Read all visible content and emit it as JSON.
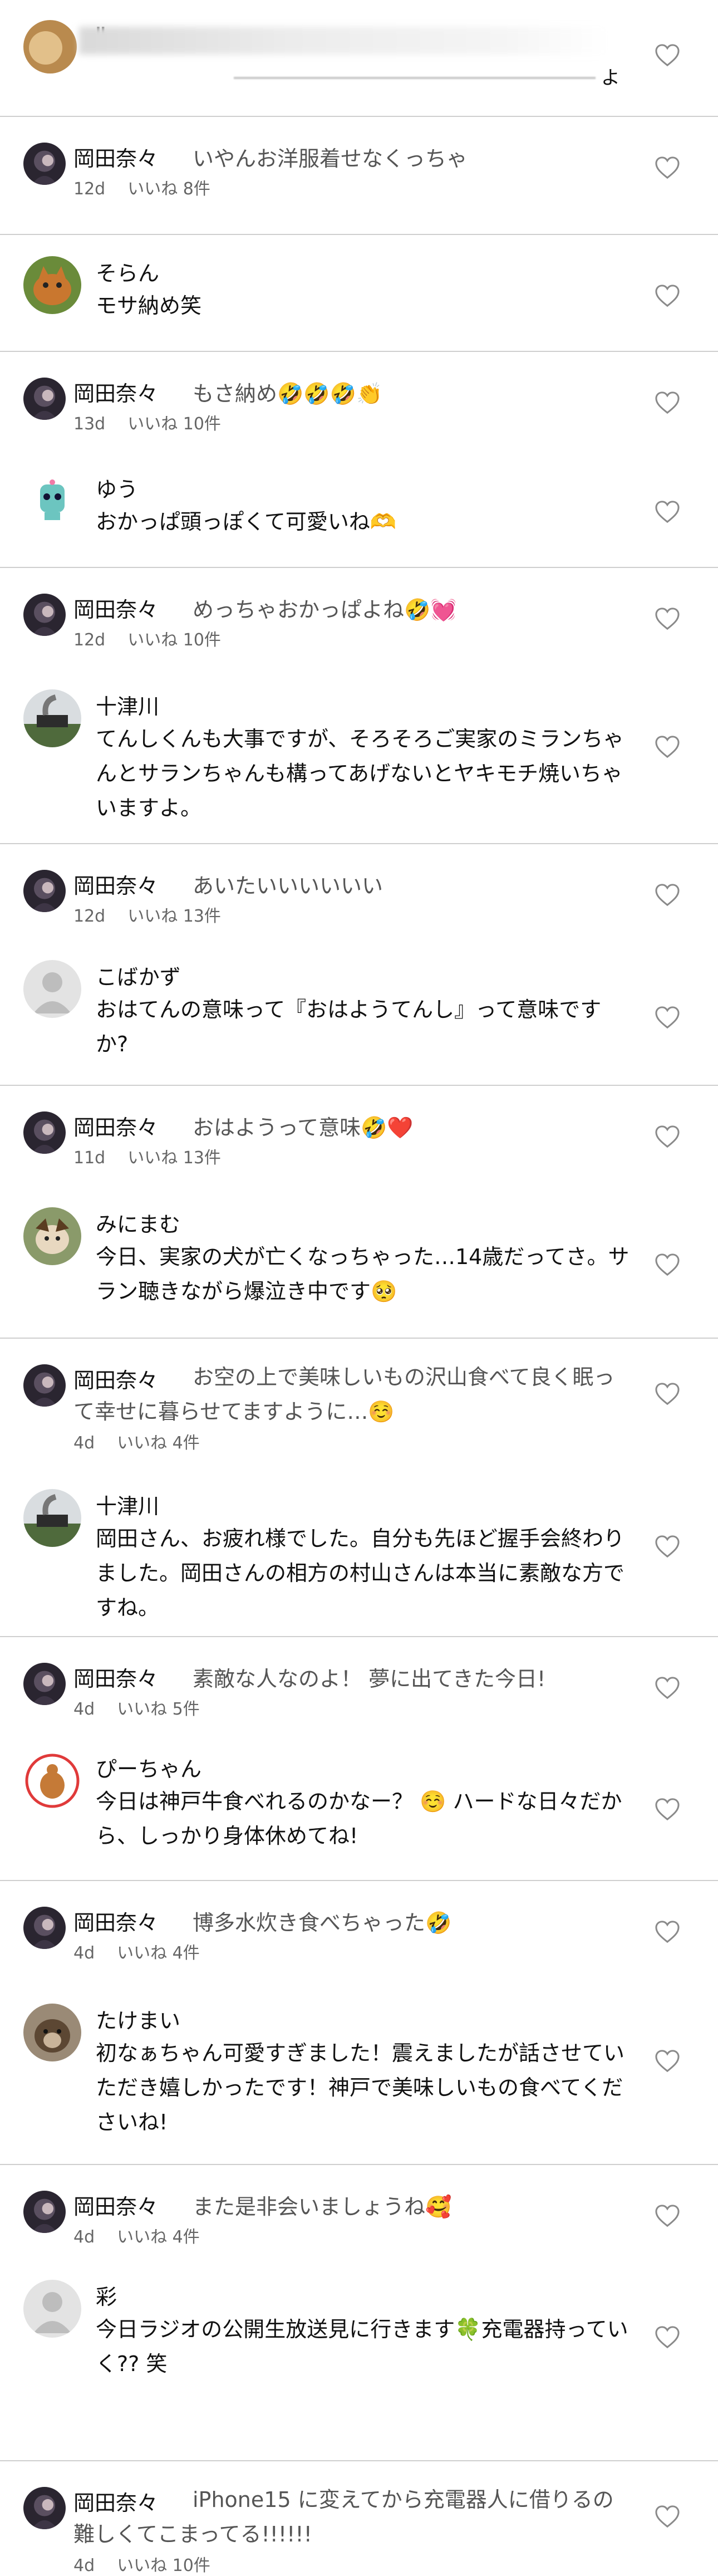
{
  "top_comment": {
    "name_fragment": "Ⅱ",
    "text_end": "よ"
  },
  "items": [
    {
      "type": "reply",
      "name": "岡田奈々",
      "text": "いやんお洋服着せなくっちゃ",
      "age": "12d",
      "likes": "いいね 8件"
    },
    {
      "type": "comment",
      "name": "そらん",
      "text": "モサ納め笑"
    },
    {
      "type": "reply",
      "name": "岡田奈々",
      "text": "もさ納め🤣🤣🤣👏",
      "age": "13d",
      "likes": "いいね 10件"
    },
    {
      "type": "comment",
      "name": "ゆう",
      "text": "おかっぱ頭っぽくて可愛いね🫶"
    },
    {
      "type": "reply",
      "name": "岡田奈々",
      "text": "めっちゃおかっぱよね🤣💓",
      "age": "12d",
      "likes": "いいね 10件"
    },
    {
      "type": "comment",
      "name": "十津川",
      "text": "てんしくんも大事ですが、そろそろご実家のミランちゃんとサランちゃんも構ってあげないとヤキモチ焼いちゃいますよ。"
    },
    {
      "type": "reply",
      "name": "岡田奈々",
      "text": "あいたいいいいいい",
      "age": "12d",
      "likes": "いいね 13件"
    },
    {
      "type": "comment",
      "name": "こばかず",
      "text": "おはてんの意味って『おはようてんし』って意味ですか?"
    },
    {
      "type": "reply",
      "name": "岡田奈々",
      "text": "おはようって意味🤣❤️",
      "age": "11d",
      "likes": "いいね 13件"
    },
    {
      "type": "comment",
      "name": "みにまむ",
      "text": "今日、実家の犬が亡くなっちゃった…14歳だってさ。サラン聴きながら爆泣き中です🥺"
    },
    {
      "type": "reply",
      "name": "岡田奈々",
      "text": "お空の上で美味しいもの沢山食べて良く眠って幸せに暮らせてますように…☺️",
      "age": "4d",
      "likes": "いいね 4件"
    },
    {
      "type": "comment",
      "name": "十津川",
      "text": "岡田さん、お疲れ様でした。自分も先ほど握手会終わりました。岡田さんの相方の村山さんは本当に素敵な方ですね。"
    },
    {
      "type": "reply",
      "name": "岡田奈々",
      "text": "素敵な人なのよ！ 夢に出てきた今日!",
      "age": "4d",
      "likes": "いいね 5件"
    },
    {
      "type": "comment",
      "name": "ぴーちゃん",
      "text": "今日は神戸牛食べれるのかなー？ ☺️ ハードな日々だから、しっかり身体休めてね!"
    },
    {
      "type": "reply",
      "name": "岡田奈々",
      "text": "博多水炊き食べちゃった🤣",
      "age": "4d",
      "likes": "いいね 4件"
    },
    {
      "type": "comment",
      "name": "たけまい",
      "text": "初なぁちゃん可愛すぎました！震えましたが話させていただき嬉しかったです！神戸で美味しいもの食べてくださいね!"
    },
    {
      "type": "reply",
      "name": "岡田奈々",
      "text": "また是非会いましょうね🥰",
      "age": "4d",
      "likes": "いいね 4件"
    },
    {
      "type": "comment",
      "name": "彩",
      "text": "今日ラジオの公開生放送見に行きます🍀充電器持っていく?? 笑"
    },
    {
      "type": "reply",
      "name": "岡田奈々",
      "text": "iPhone15 に変えてから充電器人に借りるの難しくてこまってる!!!!!!",
      "age": "4d",
      "likes": "いいね 10件"
    }
  ],
  "colors": {
    "divider": "#cfcfcf",
    "meta": "#666666",
    "reply_text": "#555555"
  }
}
